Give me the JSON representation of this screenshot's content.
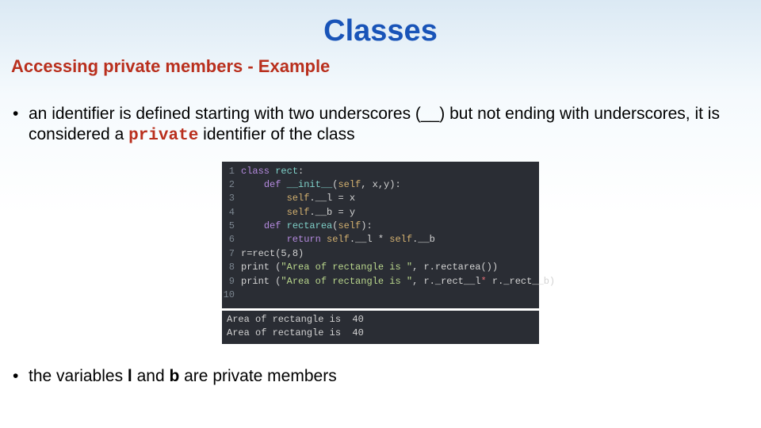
{
  "title": "Classes",
  "subtitle": "Accessing private members - Example",
  "bullet1": {
    "pre": "an identifier is defined starting with two underscores (__) but not ending with underscores, it is considered a ",
    "code": "private",
    "post": " identifier of the class"
  },
  "code": {
    "lines": [
      {
        "n": "1",
        "html": "<span class='tk-kw'>class</span> <span class='tk-fn'>rect</span>:"
      },
      {
        "n": "2",
        "html": "    <span class='tk-def'>def</span> <span class='tk-fn'>__init__</span>(<span class='tk-self'>self</span>, x,y):"
      },
      {
        "n": "3",
        "html": "        <span class='tk-self'>self</span>.__l <span class='tk-op'>=</span> x"
      },
      {
        "n": "4",
        "html": "        <span class='tk-self'>self</span>.__b <span class='tk-op'>=</span> y"
      },
      {
        "n": "5",
        "html": "    <span class='tk-def'>def</span> <span class='tk-fn'>rectarea</span>(<span class='tk-self'>self</span>):"
      },
      {
        "n": "6",
        "html": "        <span class='tk-kw'>return</span> <span class='tk-self'>self</span>.__l * <span class='tk-self'>self</span>.__b"
      },
      {
        "n": "7",
        "html": "r<span class='tk-op'>=</span>rect(5,8)"
      },
      {
        "n": "8",
        "html": "print (<span class='tk-str'>\"Area of rectangle is \"</span>, r.rectarea())"
      },
      {
        "n": "9",
        "html": "print (<span class='tk-str'>\"Area of rectangle is \"</span>, r._rect__l<span class='tk-err'>*</span> r._rect__b)"
      },
      {
        "n": "10",
        "html": ""
      }
    ]
  },
  "output": "Area of rectangle is  40\nArea of rectangle is  40",
  "bullet2": {
    "t1": "the variables ",
    "v1": "l",
    "t2": " and ",
    "v2": "b",
    "t3": " are private members"
  }
}
